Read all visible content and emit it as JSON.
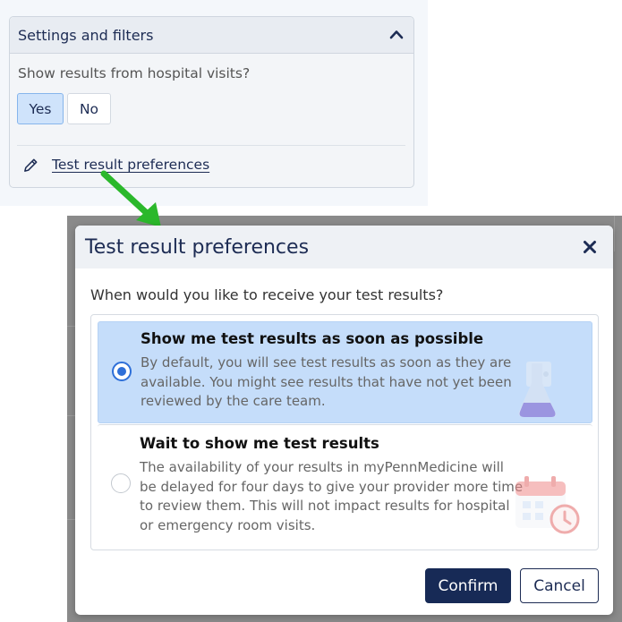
{
  "settings_panel": {
    "title": "Settings and filters",
    "question": "Show results from hospital visits?",
    "options": {
      "yes": "Yes",
      "no": "No"
    },
    "selected": "Yes",
    "link_label": "Test result preferences"
  },
  "modal": {
    "title": "Test result preferences",
    "question": "When would you like to receive your test results?",
    "options": [
      {
        "title": "Show me test results as soon as possible",
        "description": "By default, you will see test results as soon as they are available. You might see results that have not yet been reviewed by the care team.",
        "selected": true,
        "icon": "flask-icon"
      },
      {
        "title": "Wait to show me test results",
        "description": "The availability of your results in myPennMedicine will be delayed for four days to give your provider more time to review them. This will not impact results for hospital or emergency room visits.",
        "selected": false,
        "icon": "calendar-icon"
      }
    ],
    "confirm_label": "Confirm",
    "cancel_label": "Cancel"
  },
  "colors": {
    "navy": "#1d2c54",
    "selected_option_bg": "#c5ddfa",
    "radio_blue": "#2e6fd8",
    "arrow_green": "#2bb82b"
  }
}
